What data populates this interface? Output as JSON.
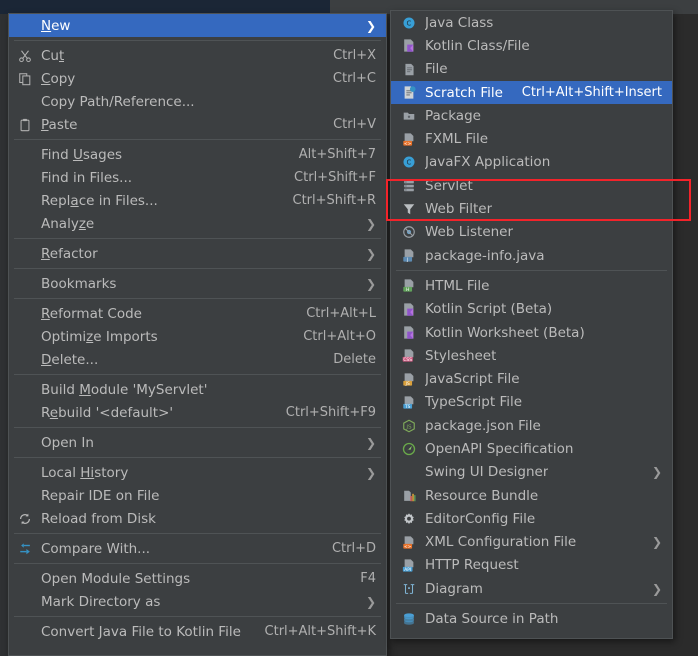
{
  "context_menu": {
    "name": "editor-context-menu",
    "groups": [
      {
        "items": [
          {
            "label": "New",
            "icon": "none",
            "submenu": true,
            "selected": true,
            "mnemonic": "N"
          }
        ]
      },
      {
        "items": [
          {
            "label": "Cut",
            "icon": "scissors-icon",
            "shortcut": "Ctrl+X",
            "mnemonic": "t"
          },
          {
            "label": "Copy",
            "icon": "copy-icon",
            "shortcut": "Ctrl+C",
            "mnemonic": "C"
          },
          {
            "label": "Copy Path/Reference...",
            "icon": "none",
            "shortcut": ""
          },
          {
            "label": "Paste",
            "icon": "clipboard-icon",
            "shortcut": "Ctrl+V",
            "mnemonic": "P"
          }
        ]
      },
      {
        "items": [
          {
            "label": "Find Usages",
            "icon": "none",
            "shortcut": "Alt+Shift+7",
            "mnemonic": "U"
          },
          {
            "label": "Find in Files...",
            "icon": "none",
            "shortcut": "Ctrl+Shift+F"
          },
          {
            "label": "Replace in Files...",
            "icon": "none",
            "shortcut": "Ctrl+Shift+R",
            "mnemonic": "a"
          },
          {
            "label": "Analyze",
            "icon": "none",
            "submenu": true,
            "mnemonic": "z"
          }
        ]
      },
      {
        "items": [
          {
            "label": "Refactor",
            "icon": "none",
            "submenu": true,
            "mnemonic": "R"
          }
        ]
      },
      {
        "items": [
          {
            "label": "Bookmarks",
            "icon": "none",
            "submenu": true
          }
        ]
      },
      {
        "items": [
          {
            "label": "Reformat Code",
            "icon": "none",
            "shortcut": "Ctrl+Alt+L",
            "mnemonic": "R"
          },
          {
            "label": "Optimize Imports",
            "icon": "none",
            "shortcut": "Ctrl+Alt+O",
            "mnemonic": "z"
          },
          {
            "label": "Delete...",
            "icon": "none",
            "shortcut": "Delete",
            "mnemonic": "D"
          }
        ]
      },
      {
        "items": [
          {
            "label": "Build Module 'MyServlet'",
            "icon": "none",
            "shortcut": "",
            "mnemonic": "M"
          },
          {
            "label": "Rebuild '<default>'",
            "icon": "none",
            "shortcut": "Ctrl+Shift+F9",
            "mnemonic": "e"
          }
        ]
      },
      {
        "items": [
          {
            "label": "Open In",
            "icon": "none",
            "submenu": true
          }
        ]
      },
      {
        "items": [
          {
            "label": "Local History",
            "icon": "none",
            "submenu": true,
            "mnemonic": "Hi"
          },
          {
            "label": "Repair IDE on File",
            "icon": "none",
            "shortcut": ""
          },
          {
            "label": "Reload from Disk",
            "icon": "reload-icon",
            "shortcut": ""
          }
        ]
      },
      {
        "items": [
          {
            "label": "Compare With...",
            "icon": "compare-icon",
            "shortcut": "Ctrl+D"
          }
        ]
      },
      {
        "items": [
          {
            "label": "Open Module Settings",
            "icon": "none",
            "shortcut": "F4"
          },
          {
            "label": "Mark Directory as",
            "icon": "none",
            "submenu": true
          }
        ]
      },
      {
        "items": [
          {
            "label": "Convert Java File to Kotlin File",
            "icon": "none",
            "shortcut": "Ctrl+Alt+Shift+K"
          }
        ]
      }
    ]
  },
  "new_submenu": {
    "name": "new-file-submenu",
    "groups": [
      {
        "items": [
          {
            "label": "Java Class",
            "icon": "java-class-icon"
          },
          {
            "label": "Kotlin Class/File",
            "icon": "kotlin-file-icon"
          },
          {
            "label": "File",
            "icon": "file-icon"
          },
          {
            "label": "Scratch File",
            "icon": "scratch-file-icon",
            "shortcut": "Ctrl+Alt+Shift+Insert",
            "selected": true
          },
          {
            "label": "Package",
            "icon": "package-icon"
          },
          {
            "label": "FXML File",
            "icon": "fxml-file-icon"
          },
          {
            "label": "JavaFX Application",
            "icon": "javafx-app-icon"
          },
          {
            "label": "Servlet",
            "icon": "servlet-icon",
            "annotated": true
          },
          {
            "label": "Web Filter",
            "icon": "web-filter-icon",
            "annotated": true
          },
          {
            "label": "Web Listener",
            "icon": "web-listener-icon"
          },
          {
            "label": "package-info.java",
            "icon": "package-info-icon"
          }
        ]
      },
      {
        "items": [
          {
            "label": "HTML File",
            "icon": "html-file-icon"
          },
          {
            "label": "Kotlin Script (Beta)",
            "icon": "kotlin-file-icon"
          },
          {
            "label": "Kotlin Worksheet (Beta)",
            "icon": "kotlin-file-icon"
          },
          {
            "label": "Stylesheet",
            "icon": "css-file-icon"
          },
          {
            "label": "JavaScript File",
            "icon": "js-file-icon"
          },
          {
            "label": "TypeScript File",
            "icon": "ts-file-icon"
          },
          {
            "label": "package.json File",
            "icon": "nodejs-icon"
          },
          {
            "label": "OpenAPI Specification",
            "icon": "openapi-icon"
          },
          {
            "label": "Swing UI Designer",
            "icon": "none",
            "submenu": true
          },
          {
            "label": "Resource Bundle",
            "icon": "resource-bundle-icon"
          },
          {
            "label": "EditorConfig File",
            "icon": "gear-icon"
          },
          {
            "label": "XML Configuration File",
            "icon": "xml-file-icon",
            "submenu": true
          },
          {
            "label": "HTTP Request",
            "icon": "http-request-icon"
          },
          {
            "label": "Diagram",
            "icon": "diagram-icon",
            "submenu": true
          }
        ]
      },
      {
        "items": [
          {
            "label": "Data Source in Path",
            "icon": "data-source-icon"
          }
        ]
      }
    ]
  },
  "annotation": {
    "name": "red-highlight-box",
    "color": "#f3232a",
    "targets": [
      "Servlet",
      "Web Filter"
    ]
  },
  "colors": {
    "menu_background": "#3c3f41",
    "menu_border": "#4e5254",
    "selection": "#3569bf",
    "text": "#bbbbbb",
    "separator": "#4f5355",
    "annotation_red": "#f3232a"
  }
}
